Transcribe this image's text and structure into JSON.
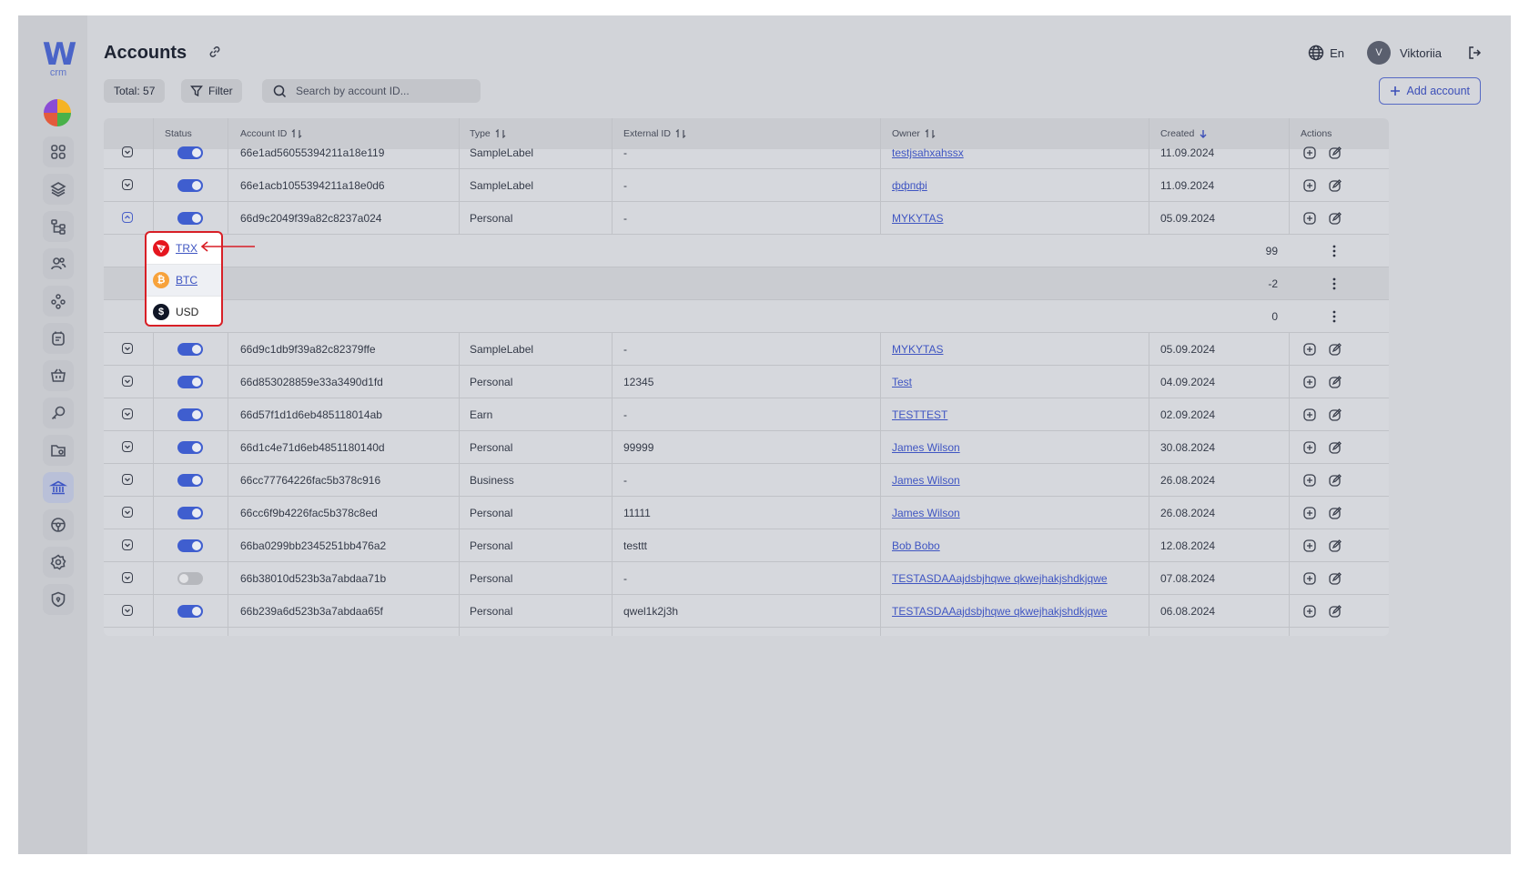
{
  "app": {
    "logo_letter": "W",
    "logo_sub": "crm"
  },
  "header": {
    "title": "Accounts",
    "language": "En",
    "user_initial": "V",
    "user_name": "Viktoriia"
  },
  "toolbar": {
    "total_label": "Total: 57",
    "filter_label": "Filter",
    "search_placeholder": "Search by account ID...",
    "add_label": "Add account"
  },
  "table": {
    "columns": {
      "status": "Status",
      "account_id": "Account ID",
      "type": "Type",
      "external_id": "External ID",
      "owner": "Owner",
      "created": "Created",
      "actions": "Actions"
    },
    "rows": [
      {
        "id": "66e1ad56055394211a18e119",
        "type": "SampleLabel",
        "external": "-",
        "owner": "testjsahxahssx",
        "created": "11.09.2024",
        "active": true
      },
      {
        "id": "66e1acb1055394211a18e0d6",
        "type": "SampleLabel",
        "external": "-",
        "owner": "ффпфі",
        "created": "11.09.2024",
        "active": true
      },
      {
        "id": "66d9c2049f39a82c8237a024",
        "type": "Personal",
        "external": "-",
        "owner": "MYKYTAS",
        "created": "05.09.2024",
        "active": true,
        "expanded": true
      },
      {
        "id": "66d9c1db9f39a82c82379ffe",
        "type": "SampleLabel",
        "external": "-",
        "owner": "MYKYTAS",
        "created": "05.09.2024",
        "active": true
      },
      {
        "id": "66d853028859e33a3490d1fd",
        "type": "Personal",
        "external": "12345",
        "owner": "Test",
        "created": "04.09.2024",
        "active": true
      },
      {
        "id": "66d57f1d1d6eb485118014ab",
        "type": "Earn",
        "external": "-",
        "owner": "TESTTEST",
        "created": "02.09.2024",
        "active": true
      },
      {
        "id": "66d1c4e71d6eb4851180140d",
        "type": "Personal",
        "external": "99999",
        "owner": "James Wilson",
        "created": "30.08.2024",
        "active": true
      },
      {
        "id": "66cc77764226fac5b378c916",
        "type": "Business",
        "external": "-",
        "owner": "James Wilson",
        "created": "26.08.2024",
        "active": true
      },
      {
        "id": "66cc6f9b4226fac5b378c8ed",
        "type": "Personal",
        "external": "11111",
        "owner": "James Wilson",
        "created": "26.08.2024",
        "active": true
      },
      {
        "id": "66ba0299bb2345251bb476a2",
        "type": "Personal",
        "external": "testtt",
        "owner": "Bob Bobo",
        "created": "12.08.2024",
        "active": true
      },
      {
        "id": "66b38010d523b3a7abdaa71b",
        "type": "Personal",
        "external": "-",
        "owner": "TESTASDAAajdsbjhqwe qkwejhakjshdkjqwe",
        "created": "07.08.2024",
        "active": false
      },
      {
        "id": "66b239a6d523b3a7abdaa65f",
        "type": "Personal",
        "external": "qwel1k2j3h",
        "owner": "TESTASDAAajdsbjhqwe qkwejhakjshdkjqwe",
        "created": "06.08.2024",
        "active": true
      }
    ],
    "wallets": [
      {
        "currency": "TRX",
        "balance": "99",
        "color": "#e5161f",
        "linked": true
      },
      {
        "currency": "BTC",
        "balance": "-2",
        "color": "#f7a23b",
        "linked": true
      },
      {
        "currency": "USD",
        "balance": "0",
        "color": "#101626",
        "linked": false
      }
    ]
  },
  "icons": [
    "link-icon",
    "globe-icon",
    "logout-icon",
    "filter-icon",
    "search-icon",
    "plus-icon",
    "sort-icon",
    "sort-down-icon",
    "chevron-down-icon",
    "chevron-up-icon",
    "add-circle-icon",
    "edit-icon",
    "kebab-icon",
    "arrow-left-icon"
  ],
  "colors": {
    "accent": "#3f5ecf",
    "highlight": "#d81f26"
  }
}
